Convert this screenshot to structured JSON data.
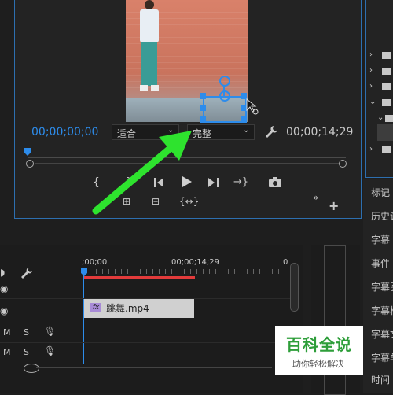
{
  "monitor": {
    "timecode_current": "00;00;00;00",
    "fit_label": "适合",
    "quality_label": "完整",
    "timecode_duration": "00;00;14;29"
  },
  "timeline": {
    "ruler_start": ";00;00",
    "ruler_mid": "00;00;14;29",
    "ruler_end": "0",
    "clip_name": "跳舞.mp4",
    "clip_fx": "fx",
    "track_labels": [
      {
        "m": "M",
        "s": "S"
      },
      {
        "m": "M",
        "s": "S"
      }
    ]
  },
  "right_panel": {
    "items": [
      "标记",
      "历史记",
      "字幕",
      "事件",
      "字幕图",
      "字幕样",
      "字幕文",
      "字幕羊",
      "时间"
    ]
  },
  "watermark": {
    "title": "百科全说",
    "subtitle": "助你轻松解决"
  },
  "colors": {
    "accent": "#2d8ceb",
    "arrow": "#2ee32e",
    "playhead": "#2d8ceb",
    "work_area": "#e33b3b"
  }
}
